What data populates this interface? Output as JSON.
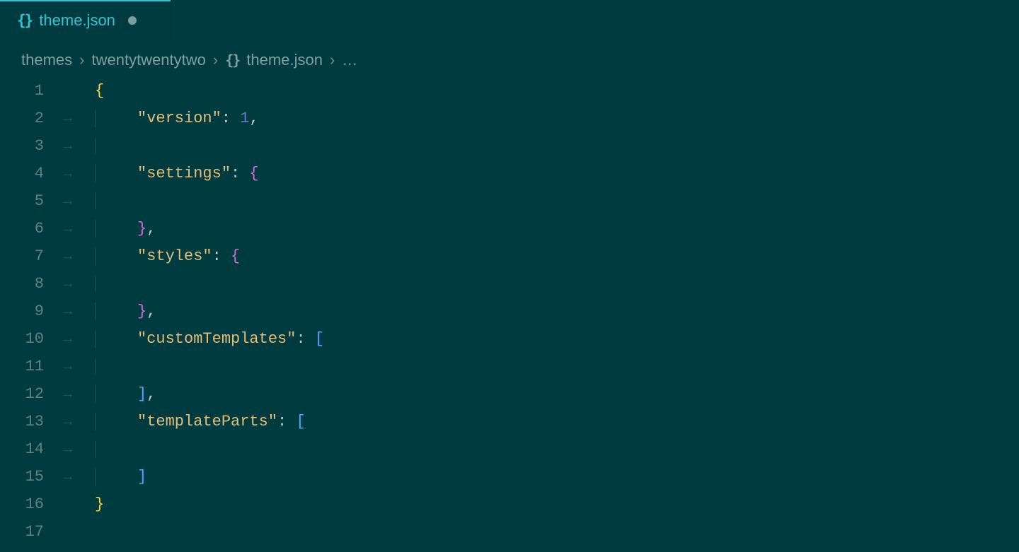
{
  "tab": {
    "icon": "{}",
    "label": "theme.json",
    "dirty": true
  },
  "breadcrumbs": {
    "sep": "›",
    "items": [
      {
        "label": "themes"
      },
      {
        "label": "twentytwentytwo"
      },
      {
        "icon": "{}",
        "label": "theme.json"
      },
      {
        "label": "…"
      }
    ]
  },
  "editor": {
    "lines": [
      {
        "n": "1",
        "indent": 0,
        "tokens": [
          {
            "t": "{",
            "c": "brace-yellow"
          }
        ]
      },
      {
        "n": "2",
        "indent": 1,
        "tokens": [
          {
            "t": "\"version\"",
            "c": "key"
          },
          {
            "t": ":",
            "c": "colon"
          },
          {
            "t": " 1",
            "c": "num"
          },
          {
            "t": ",",
            "c": "comma"
          }
        ]
      },
      {
        "n": "3",
        "indent": 1,
        "tokens": []
      },
      {
        "n": "4",
        "indent": 1,
        "tokens": [
          {
            "t": "\"settings\"",
            "c": "key"
          },
          {
            "t": ":",
            "c": "colon"
          },
          {
            "t": " {",
            "c": "brace-purple"
          }
        ]
      },
      {
        "n": "5",
        "indent": 1,
        "tokens": []
      },
      {
        "n": "6",
        "indent": 1,
        "tokens": [
          {
            "t": "}",
            "c": "brace-purple"
          },
          {
            "t": ",",
            "c": "comma"
          }
        ]
      },
      {
        "n": "7",
        "indent": 1,
        "tokens": [
          {
            "t": "\"styles\"",
            "c": "key"
          },
          {
            "t": ":",
            "c": "colon"
          },
          {
            "t": " {",
            "c": "brace-purple"
          }
        ]
      },
      {
        "n": "8",
        "indent": 1,
        "tokens": []
      },
      {
        "n": "9",
        "indent": 1,
        "tokens": [
          {
            "t": "}",
            "c": "brace-purple"
          },
          {
            "t": ",",
            "c": "comma"
          }
        ]
      },
      {
        "n": "10",
        "indent": 1,
        "tokens": [
          {
            "t": "\"customTemplates\"",
            "c": "key"
          },
          {
            "t": ":",
            "c": "colon"
          },
          {
            "t": " [",
            "c": "brace-blue"
          }
        ]
      },
      {
        "n": "11",
        "indent": 1,
        "tokens": []
      },
      {
        "n": "12",
        "indent": 1,
        "tokens": [
          {
            "t": "]",
            "c": "brace-blue"
          },
          {
            "t": ",",
            "c": "comma"
          }
        ]
      },
      {
        "n": "13",
        "indent": 1,
        "tokens": [
          {
            "t": "\"templateParts\"",
            "c": "key"
          },
          {
            "t": ":",
            "c": "colon"
          },
          {
            "t": " [",
            "c": "brace-blue"
          }
        ]
      },
      {
        "n": "14",
        "indent": 1,
        "tokens": []
      },
      {
        "n": "15",
        "indent": 1,
        "tokens": [
          {
            "t": "]",
            "c": "brace-blue"
          }
        ]
      },
      {
        "n": "16",
        "indent": 0,
        "tokens": [
          {
            "t": "}",
            "c": "brace-yellow"
          }
        ]
      },
      {
        "n": "17",
        "indent": 0,
        "tokens": []
      }
    ],
    "wsGlyph": "→"
  }
}
